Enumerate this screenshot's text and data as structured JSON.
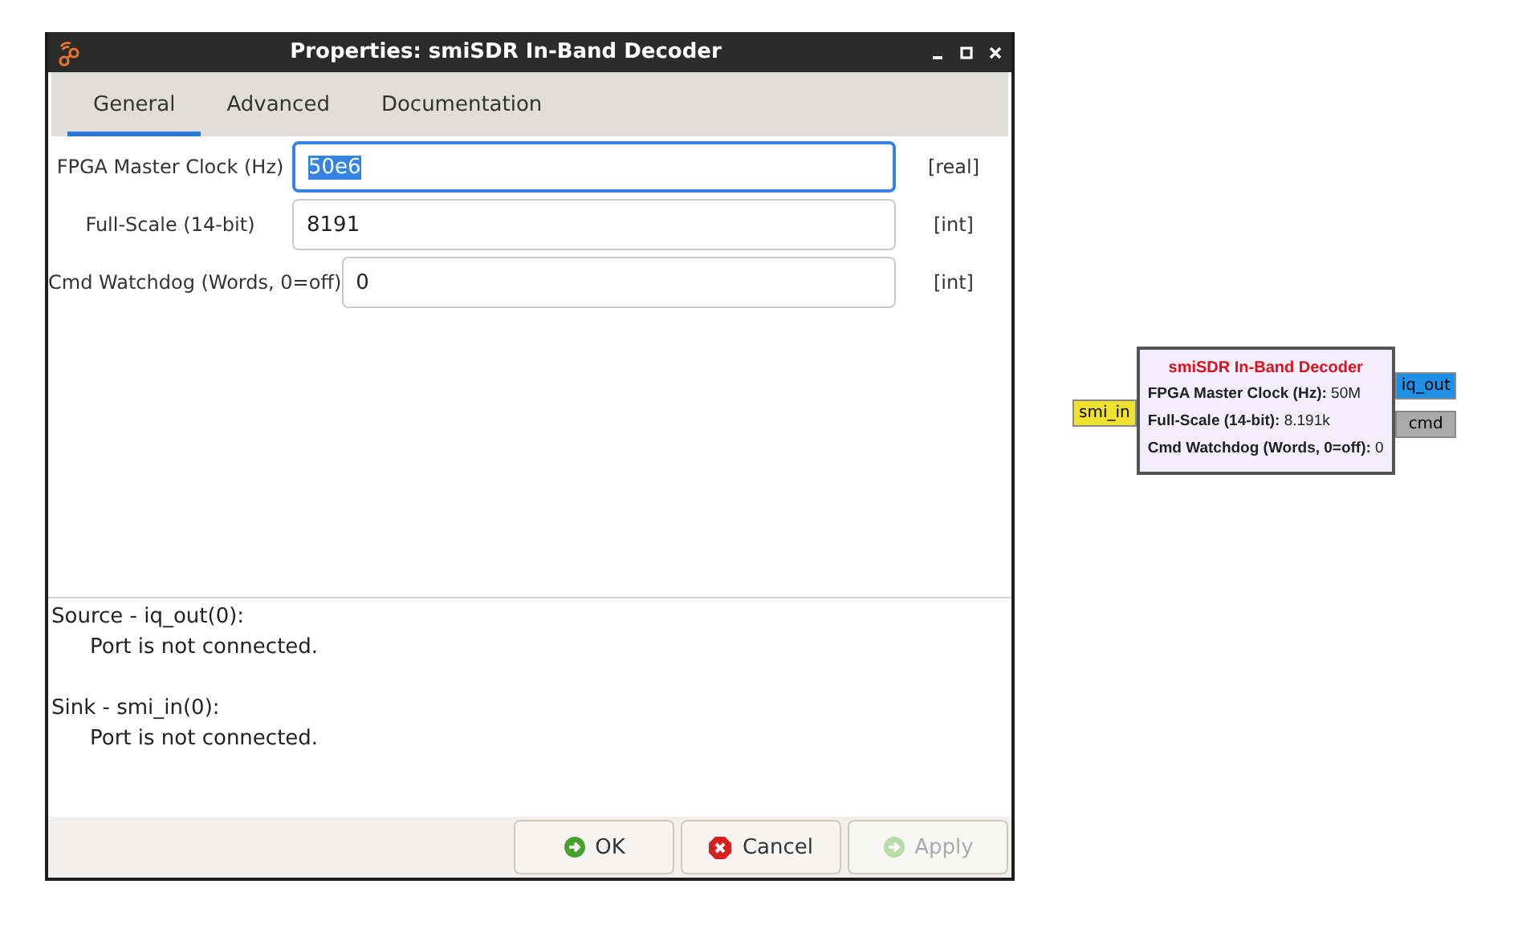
{
  "window": {
    "title": "Properties: smiSDR In-Band Decoder"
  },
  "tabs": [
    {
      "label": "General",
      "selected": true
    },
    {
      "label": "Advanced",
      "selected": false
    },
    {
      "label": "Documentation",
      "selected": false
    }
  ],
  "params": [
    {
      "label": "FPGA Master Clock (Hz)",
      "value": "50e6",
      "type": "[real]",
      "focused": true
    },
    {
      "label": "Full-Scale (14-bit)",
      "value": "8191",
      "type": "[int]",
      "focused": false
    },
    {
      "label": "Cmd Watchdog (Words, 0=off)",
      "value": "0",
      "type": "[int]",
      "focused": false
    }
  ],
  "messages": [
    {
      "heading": "Source - iq_out(0):",
      "text": "Port is not connected."
    },
    {
      "heading": "Sink - smi_in(0):",
      "text": "Port is not connected."
    }
  ],
  "buttons": [
    {
      "label": "OK",
      "kind": "ok",
      "disabled": false
    },
    {
      "label": "Cancel",
      "kind": "cancel",
      "disabled": false
    },
    {
      "label": "Apply",
      "kind": "apply",
      "disabled": true
    }
  ],
  "block": {
    "title": "smiSDR In-Band Decoder",
    "params": [
      {
        "name": "FPGA Master Clock (Hz):",
        "value": "50M"
      },
      {
        "name": "Full-Scale (14-bit):",
        "value": "8.191k"
      },
      {
        "name": "Cmd Watchdog (Words, 0=off):",
        "value": "0"
      }
    ],
    "inputs": [
      {
        "label": "smi_in",
        "color": "#f0e130"
      }
    ],
    "outputs": [
      {
        "label": "iq_out",
        "color": "#1e90e8"
      },
      {
        "label": "cmd",
        "color": "#aaaaaa"
      }
    ]
  }
}
